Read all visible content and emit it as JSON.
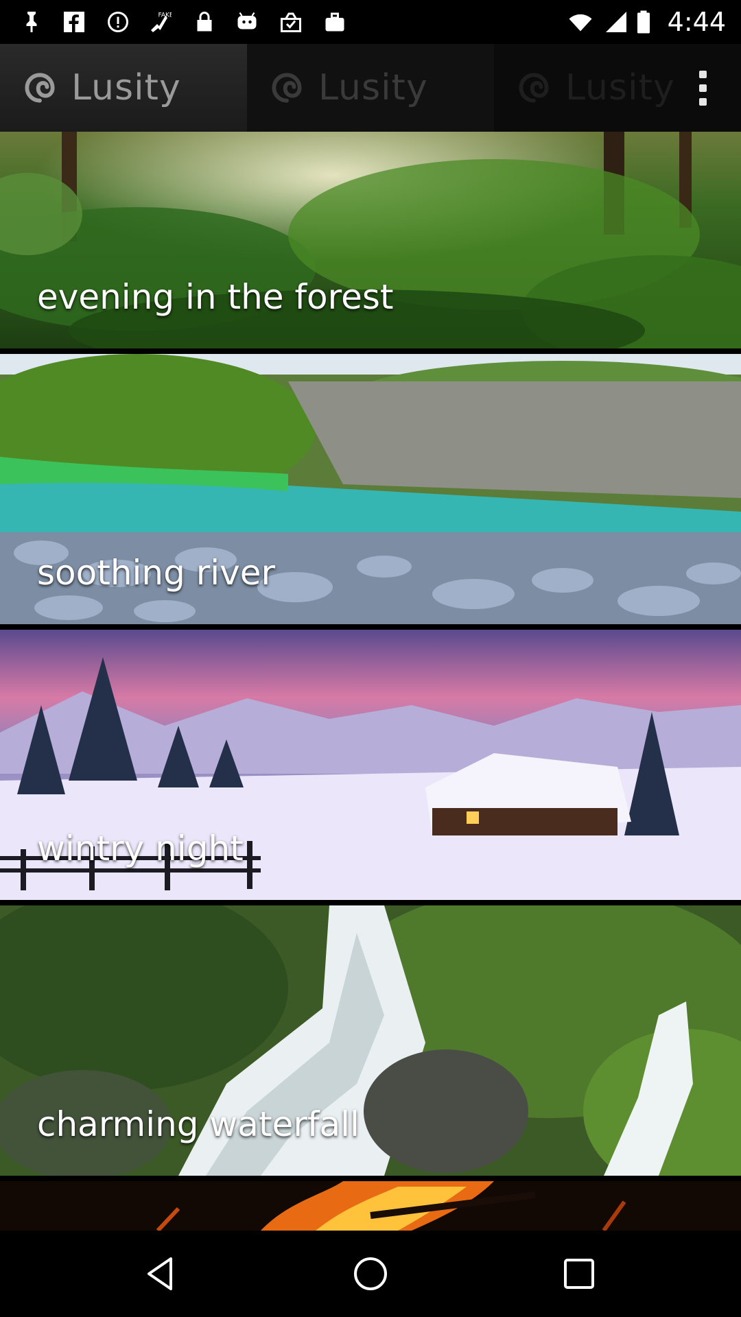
{
  "status_bar": {
    "time": "4:44",
    "left_icons": [
      "pin-icon",
      "facebook-icon",
      "alert-icon",
      "fake-gps-icon",
      "lock-icon",
      "android-icon",
      "clipboard-check-icon",
      "briefcase-icon"
    ],
    "right_icons": [
      "wifi-icon",
      "signal-icon",
      "battery-icon"
    ]
  },
  "app_bar": {
    "app_name": "Lusity",
    "tiles": [
      "Lusity",
      "Lusity",
      "Lusity"
    ],
    "menu_icon": "more-vert-icon"
  },
  "scenes": [
    {
      "title": "evening in the forest"
    },
    {
      "title": "soothing river"
    },
    {
      "title": "wintry night"
    },
    {
      "title": "charming waterfall"
    },
    {
      "title": ""
    }
  ],
  "nav_bar": {
    "buttons": [
      "back-icon",
      "home-icon",
      "recents-icon"
    ]
  },
  "colors": {
    "background": "#000000",
    "text": "#ffffff",
    "forest": "#2f5a1e",
    "river": "#2fb3b0",
    "winter": "#b9a6d8",
    "waterfall": "#3f5f2a",
    "fire": "#e06010"
  }
}
